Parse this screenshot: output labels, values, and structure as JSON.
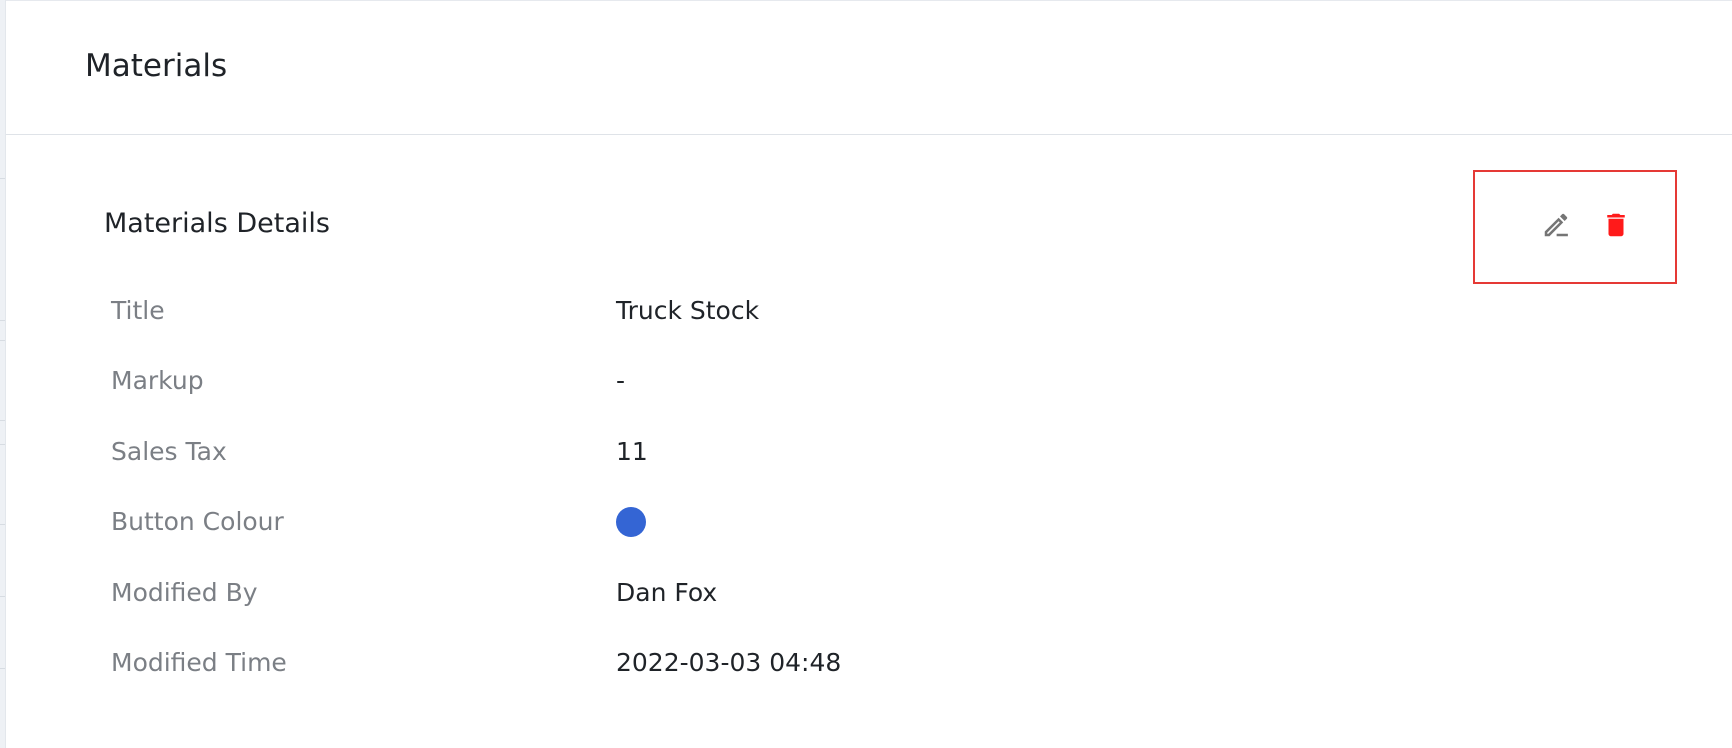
{
  "header": {
    "title": "Materials"
  },
  "card": {
    "title": "Materials Details",
    "actions": [
      {
        "name": "edit",
        "icon": "pencil-icon",
        "color": "#757575"
      },
      {
        "name": "delete",
        "icon": "trash-icon",
        "color": "#ff1a1a"
      }
    ],
    "highlight_color": "#e53935"
  },
  "details": [
    {
      "label": "Title",
      "value": "Truck Stock"
    },
    {
      "label": "Markup",
      "value": "-"
    },
    {
      "label": "Sales Tax",
      "value": "11"
    },
    {
      "label": "Button Colour",
      "value": "",
      "swatch_color": "#3465d4"
    },
    {
      "label": "Modified By",
      "value": "Dan Fox"
    },
    {
      "label": "Modified Time",
      "value": "2022-03-03 04:48"
    }
  ]
}
